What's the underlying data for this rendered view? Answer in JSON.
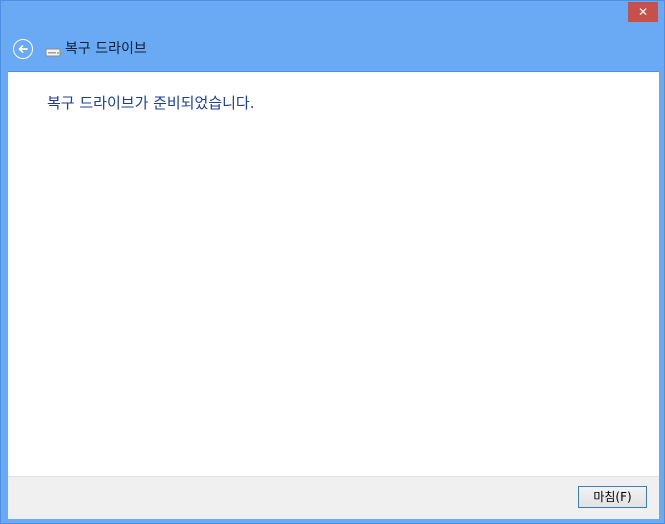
{
  "window": {
    "title": "복구 드라이브",
    "close_glyph": "✕",
    "accent_color": "#6aa9f4",
    "close_color": "#c7504b"
  },
  "icons": {
    "back": "back-arrow-icon",
    "drive": "drive-icon",
    "close": "close-icon"
  },
  "content": {
    "message": "복구 드라이브가 준비되었습니다."
  },
  "footer": {
    "finish_label": "마침(F)"
  }
}
